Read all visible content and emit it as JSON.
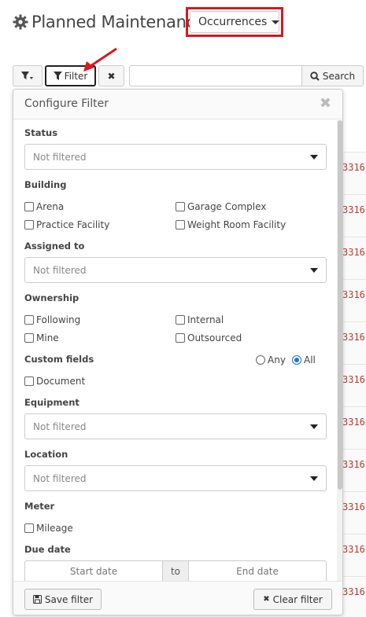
{
  "header": {
    "title": "Planned Maintenance",
    "view_dropdown": "Occurrences",
    "icon": "gear-icon"
  },
  "toolbar": {
    "filter_label": "Filter",
    "clear_symbol": "✖",
    "search_label": "Search",
    "search_value": ""
  },
  "background_rows": [
    "3316",
    "3316",
    "3316",
    "3316",
    "3316",
    "3316",
    "3316",
    "3316",
    "3316",
    "3316",
    "3316"
  ],
  "panel": {
    "title": "Configure Filter",
    "close_symbol": "✖",
    "status": {
      "label": "Status",
      "value": "Not filtered"
    },
    "building": {
      "label": "Building",
      "options": [
        "Arena",
        "Garage Complex",
        "Practice Facility",
        "Weight Room Facility"
      ]
    },
    "assigned_to": {
      "label": "Assigned to",
      "value": "Not filtered"
    },
    "ownership": {
      "label": "Ownership",
      "options": [
        "Following",
        "Internal",
        "Mine",
        "Outsourced"
      ]
    },
    "custom_fields": {
      "label": "Custom fields",
      "radio_any": "Any",
      "radio_all": "All",
      "selected": "All",
      "options": [
        "Document"
      ]
    },
    "equipment": {
      "label": "Equipment",
      "value": "Not filtered"
    },
    "location": {
      "label": "Location",
      "value": "Not filtered"
    },
    "meter": {
      "label": "Meter",
      "options": [
        "Mileage"
      ]
    },
    "due_date": {
      "label": "Due date",
      "start_placeholder": "Start date",
      "to_label": "to",
      "end_placeholder": "End date"
    },
    "footer": {
      "save_label": "Save filter",
      "clear_label": "Clear filter"
    }
  },
  "colors": {
    "highlight_red": "#e0141c",
    "accent_blue": "#1a73e8",
    "row_text_red": "#c0392b"
  }
}
